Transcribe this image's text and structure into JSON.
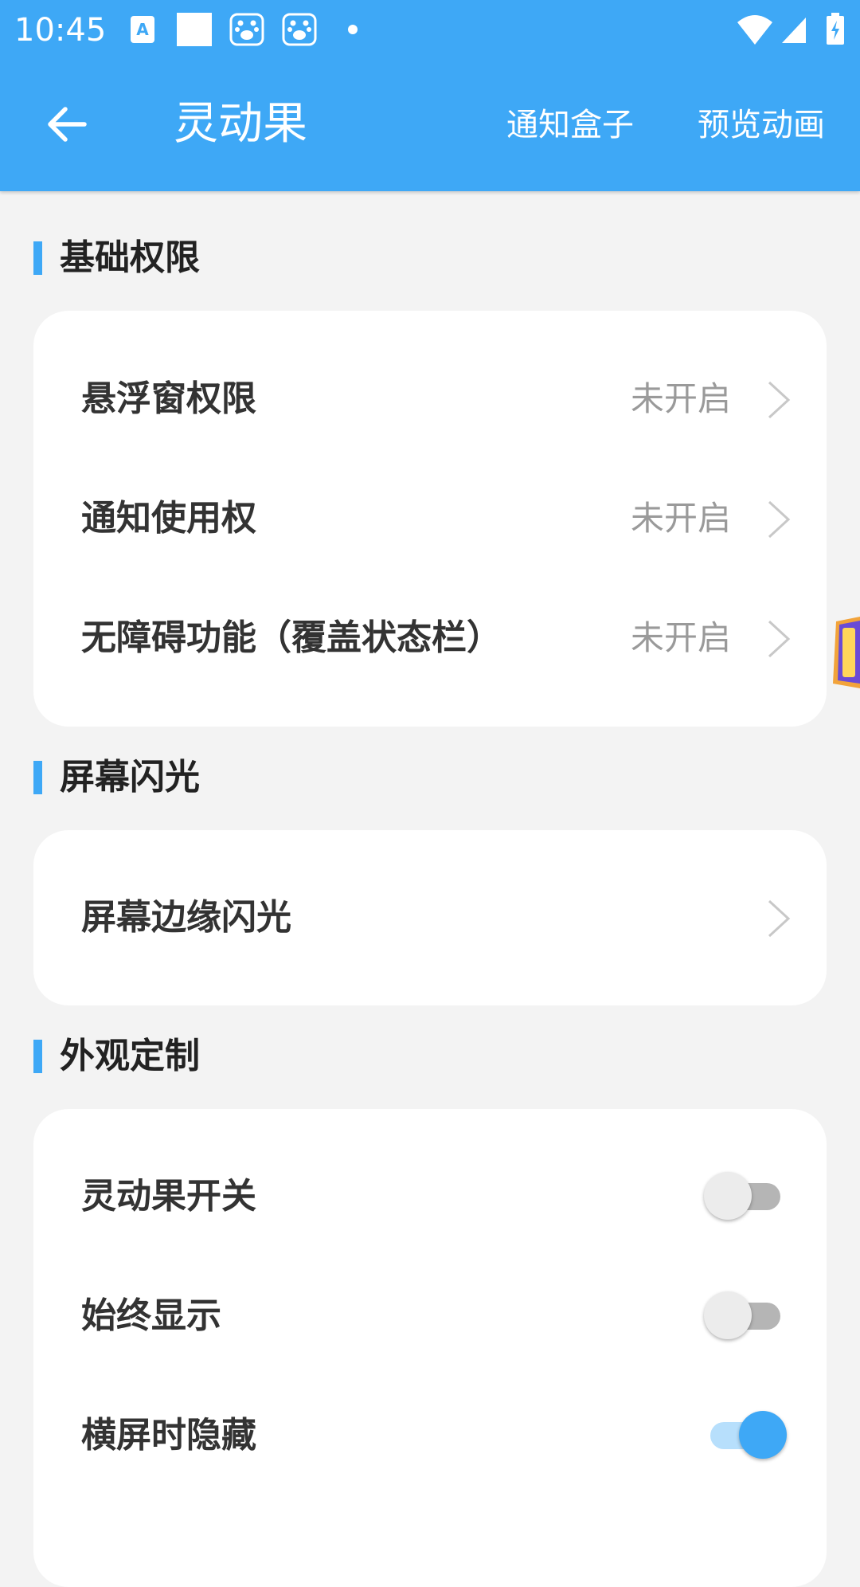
{
  "status_bar": {
    "time": "10:45"
  },
  "app_bar": {
    "back_icon": "arrow-left-icon",
    "title": "灵动果",
    "action_notification_box": "通知盒子",
    "action_preview_animation": "预览动画"
  },
  "sections": [
    {
      "title": "基础权限",
      "rows": [
        {
          "label": "悬浮窗权限",
          "value": "未开启"
        },
        {
          "label": "通知使用权",
          "value": "未开启"
        },
        {
          "label": "无障碍功能（覆盖状态栏）",
          "value": "未开启"
        }
      ]
    },
    {
      "title": "屏幕闪光",
      "rows": [
        {
          "label": "屏幕边缘闪光"
        }
      ]
    },
    {
      "title": "外观定制",
      "rows": [
        {
          "label": "灵动果开关",
          "toggle": false
        },
        {
          "label": "始终显示",
          "toggle": false
        },
        {
          "label": "横屏时隐藏",
          "toggle": true
        }
      ]
    }
  ],
  "colors": {
    "accent": "#3ea8f6",
    "background": "#f3f3f3",
    "card": "#ffffff",
    "secondary_text": "#9a9a9a"
  }
}
